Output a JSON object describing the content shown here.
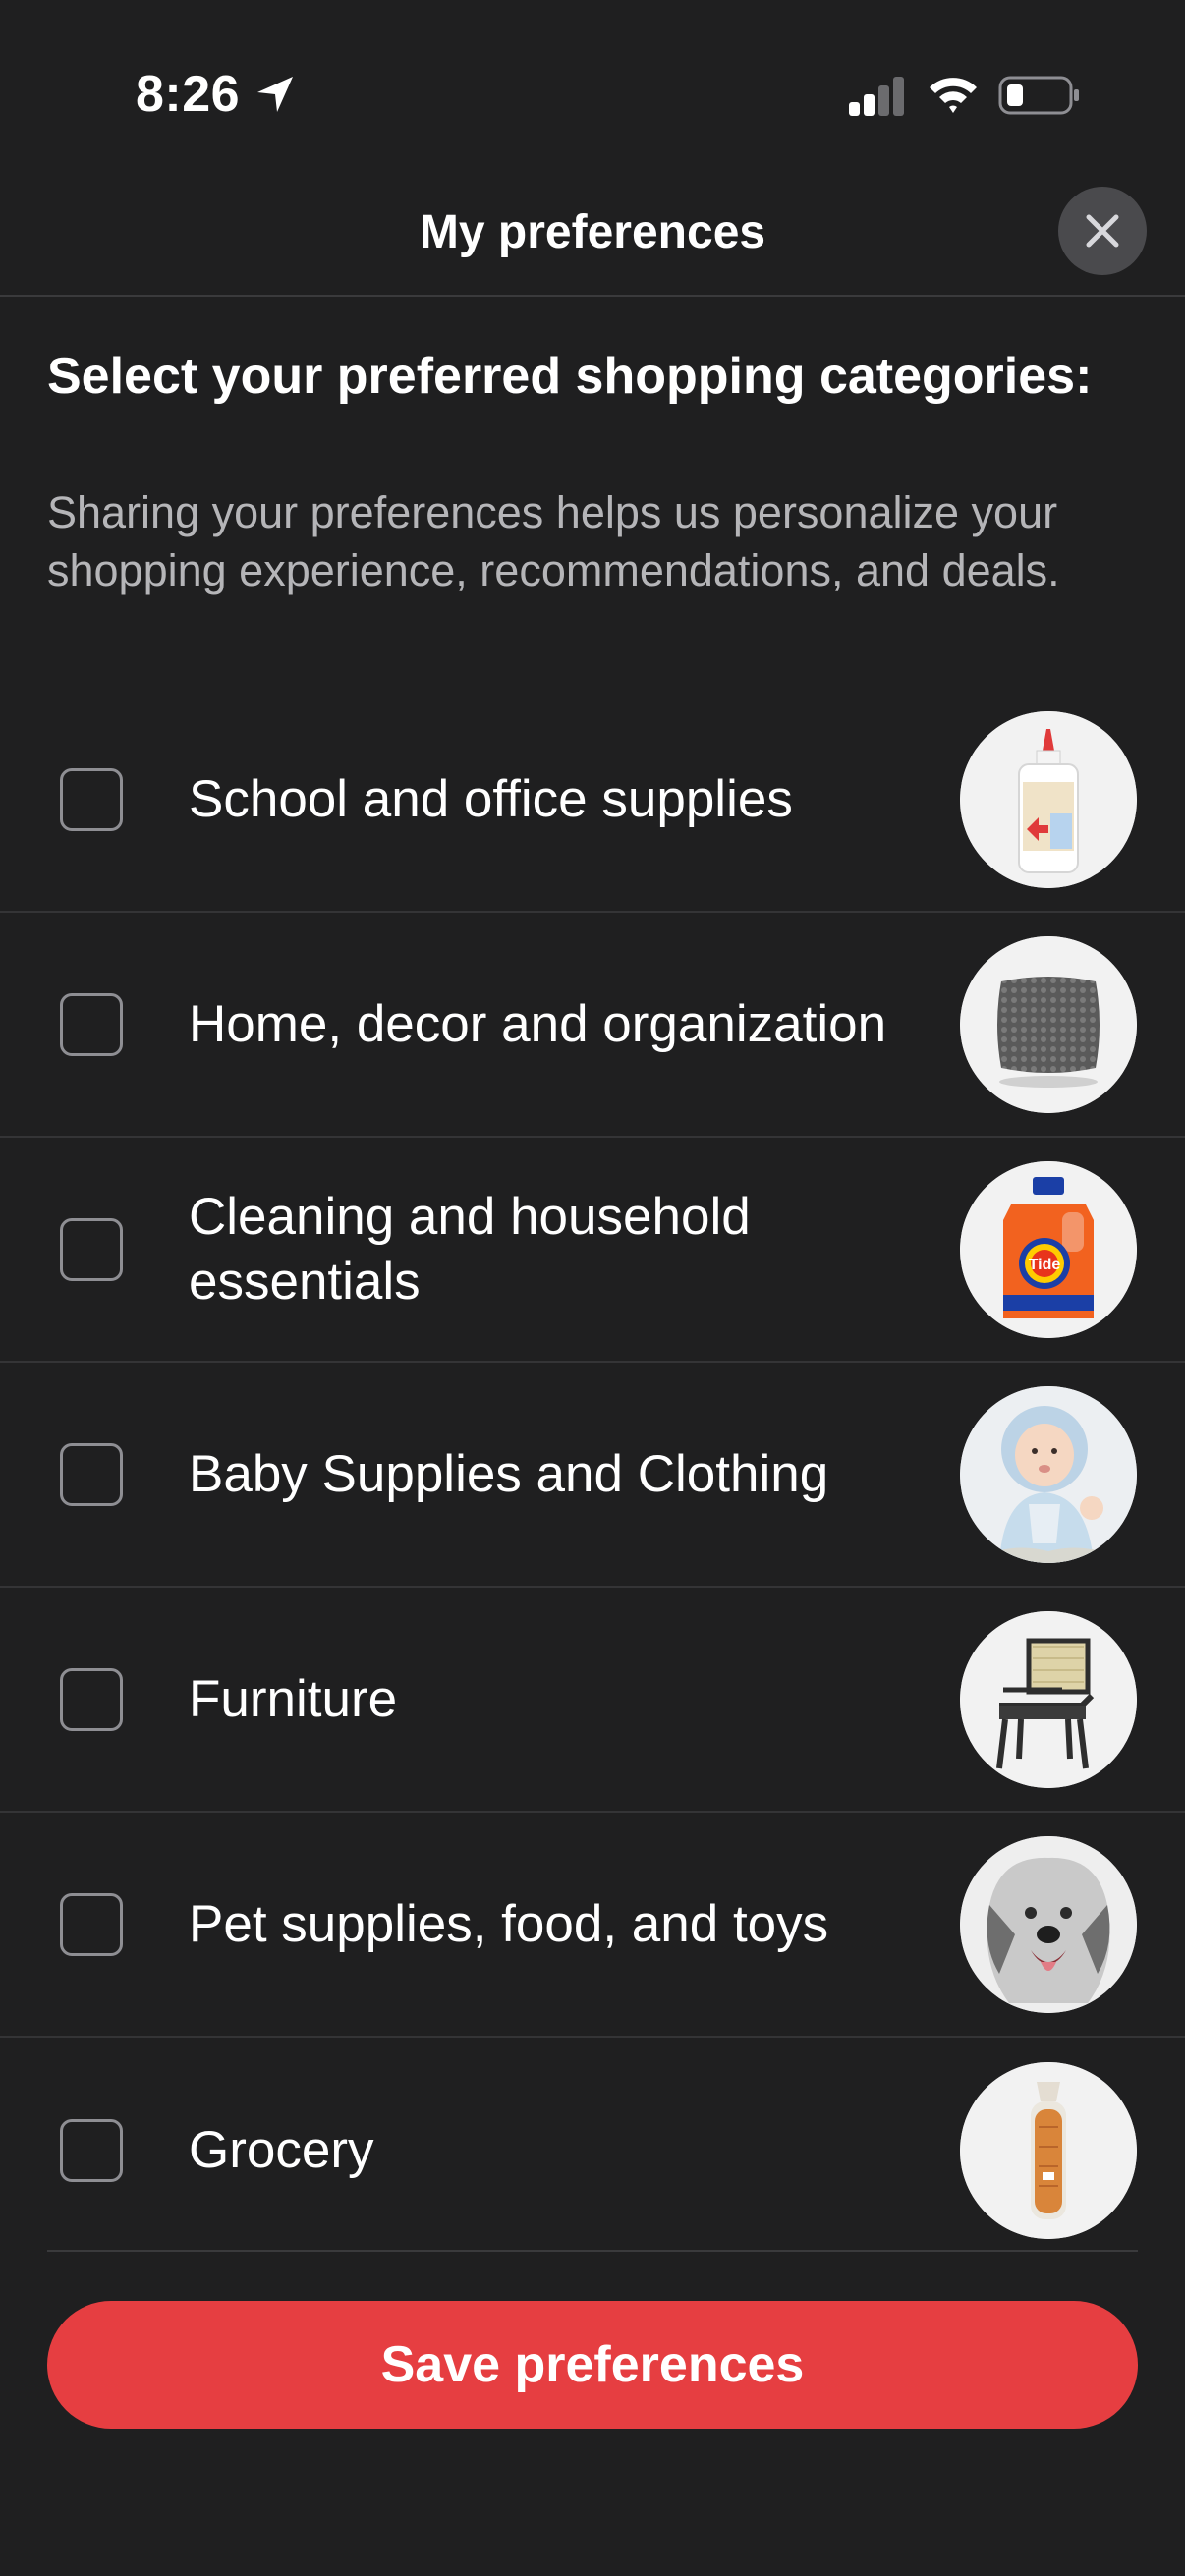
{
  "status_bar": {
    "time": "8:26"
  },
  "header": {
    "title": "My preferences",
    "close_icon": "close-icon"
  },
  "intro": {
    "heading": "Select your preferred shopping categories:",
    "description": "Sharing your preferences helps us personalize your shopping experience, recommendations, and deals."
  },
  "categories": [
    {
      "label": "School and office supplies",
      "checked": false,
      "icon": "glue-bottle-image"
    },
    {
      "label": "Home, decor and organization",
      "checked": false,
      "icon": "pillow-image"
    },
    {
      "label": "Cleaning and household essentials",
      "checked": false,
      "icon": "detergent-image"
    },
    {
      "label": "Baby Supplies and Clothing",
      "checked": false,
      "icon": "baby-image"
    },
    {
      "label": "Furniture",
      "checked": false,
      "icon": "chair-image"
    },
    {
      "label": "Pet supplies, food, and toys",
      "checked": false,
      "icon": "dog-image"
    },
    {
      "label": "Grocery",
      "checked": false,
      "icon": "bread-image"
    }
  ],
  "footer": {
    "save_label": "Save preferences"
  },
  "colors": {
    "background": "#1f1f20",
    "accent": "#e63e41",
    "divider": "#343436"
  }
}
